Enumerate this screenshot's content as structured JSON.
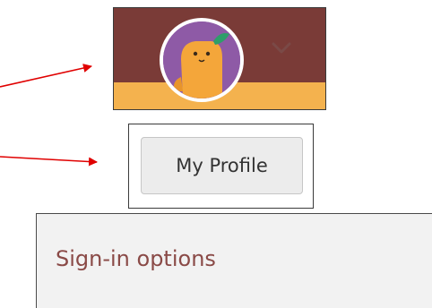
{
  "header": {
    "avatar_icon": "user-avatar-mascot",
    "dropdown_icon": "chevron-down-icon",
    "colors": {
      "background": "#7a3b37",
      "band": "#f4b24e",
      "avatar_bg": "#8e5aa6"
    }
  },
  "profile": {
    "button_label": "My Profile"
  },
  "signin": {
    "link_label": "Sign-in options",
    "color": "#8a4a47"
  },
  "annotations": {
    "arrow_color": "#e00000"
  }
}
